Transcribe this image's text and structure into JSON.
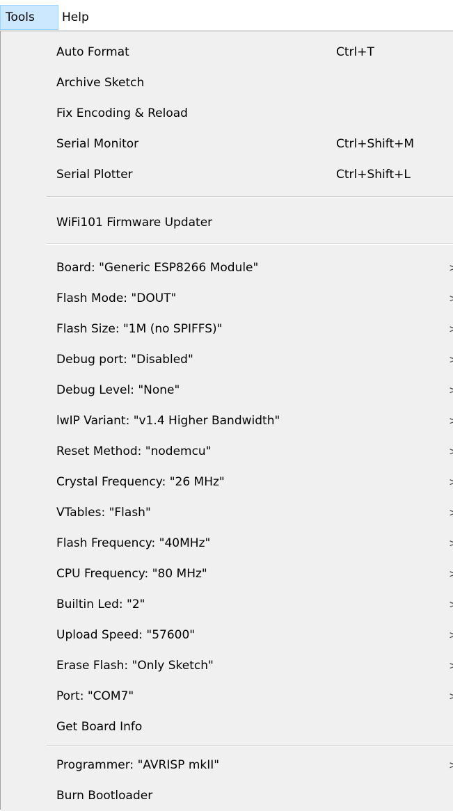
{
  "menubar": {
    "tools_label": "Tools",
    "help_label": "Help"
  },
  "tools_menu": {
    "group1": [
      {
        "label": "Auto Format",
        "shortcut": "Ctrl+T"
      },
      {
        "label": "Archive Sketch",
        "shortcut": ""
      },
      {
        "label": "Fix Encoding & Reload",
        "shortcut": ""
      },
      {
        "label": "Serial Monitor",
        "shortcut": "Ctrl+Shift+M"
      },
      {
        "label": "Serial Plotter",
        "shortcut": "Ctrl+Shift+L"
      }
    ],
    "group2": [
      {
        "label": "WiFi101 Firmware Updater"
      }
    ],
    "group3": [
      {
        "label": "Board: \"Generic ESP8266 Module\"",
        "submenu": true
      },
      {
        "label": "Flash Mode: \"DOUT\"",
        "submenu": true
      },
      {
        "label": "Flash Size: \"1M (no SPIFFS)\"",
        "submenu": true
      },
      {
        "label": "Debug port: \"Disabled\"",
        "submenu": true
      },
      {
        "label": "Debug Level: \"None\"",
        "submenu": true
      },
      {
        "label": "lwIP Variant: \"v1.4 Higher Bandwidth\"",
        "submenu": true
      },
      {
        "label": "Reset Method: \"nodemcu\"",
        "submenu": true
      },
      {
        "label": "Crystal Frequency: \"26 MHz\"",
        "submenu": true
      },
      {
        "label": "VTables: \"Flash\"",
        "submenu": true
      },
      {
        "label": "Flash Frequency: \"40MHz\"",
        "submenu": true
      },
      {
        "label": "CPU Frequency: \"80 MHz\"",
        "submenu": true
      },
      {
        "label": "Builtin Led: \"2\"",
        "submenu": true
      },
      {
        "label": "Upload Speed: \"57600\"",
        "submenu": true
      },
      {
        "label": "Erase Flash: \"Only Sketch\"",
        "submenu": true
      },
      {
        "label": "Port: \"COM7\"",
        "submenu": true
      },
      {
        "label": "Get Board Info",
        "submenu": false
      }
    ],
    "group4": [
      {
        "label": "Programmer: \"AVRISP mkII\"",
        "submenu": true
      },
      {
        "label": "Burn Bootloader",
        "submenu": false
      }
    ],
    "submenu_arrow": ">"
  },
  "colors": {
    "menu_bg": "#f0f0f0",
    "active_menu_bg": "#cce8ff",
    "active_menu_border": "#99d1ff",
    "separator": "#d0d0d0"
  }
}
